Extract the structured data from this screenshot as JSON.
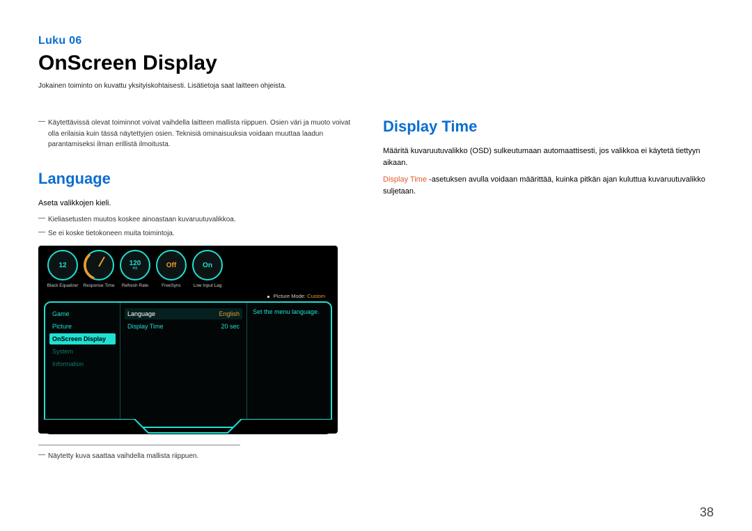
{
  "chapter_label": "Luku 06",
  "page_title": "OnScreen Display",
  "page_subtitle": "Jokainen toiminto on kuvattu yksityiskohtaisesti. Lisätietoja saat laitteen ohjeista.",
  "page_number": "38",
  "left": {
    "top_note": "Käytettävissä olevat toiminnot voivat vaihdella laitteen mallista riippuen. Osien väri ja muoto voivat olla erilaisia kuin tässä näytettyjen osien. Teknisiä ominaisuuksia voidaan muuttaa laadun parantamiseksi ilman erillistä ilmoitusta.",
    "h2": "Language",
    "intro": "Aseta valikkojen kieli.",
    "notes": [
      "Kieliasetusten muutos koskee ainoastaan kuvaruutuvalikkoa.",
      "Se ei koske tietokoneen muita toimintoja."
    ],
    "footnote": "Näytetty kuva saattaa vaihdella mallista riippuen."
  },
  "right": {
    "h2": "Display Time",
    "p1": "Määritä kuvaruutuvalikko (OSD) sulkeutumaan automaattisesti, jos valikkoa ei käytetä tiettyyn aikaan.",
    "p2_prefix": "Display Time",
    "p2_rest": " -asetuksen avulla voidaan määrittää, kuinka pitkän ajan kuluttua kuvaruutuvalikko suljetaan."
  },
  "osd": {
    "dials": [
      {
        "value": "12",
        "sub": "",
        "label": "Black Equalizer"
      },
      {
        "value": "",
        "sub": "",
        "label": "Response Time",
        "gauge": true
      },
      {
        "value": "120",
        "sub": "Hz",
        "label": "Refresh Rate"
      },
      {
        "value": "Off",
        "sub": "",
        "label": "FreeSync",
        "off": true
      },
      {
        "value": "On",
        "sub": "",
        "label": "Low Input Lag"
      }
    ],
    "picture_mode_label": "Picture Mode:",
    "picture_mode_value": "Custom",
    "sidebar": [
      {
        "label": "Game"
      },
      {
        "label": "Picture"
      },
      {
        "label": "OnScreen Display",
        "selected": true
      },
      {
        "label": "System",
        "muted": true
      },
      {
        "label": "Information",
        "muted": true
      }
    ],
    "settings": [
      {
        "label": "Language",
        "value": "English",
        "selected": true
      },
      {
        "label": "Display Time",
        "value": "20 sec"
      }
    ],
    "description": "Set the menu language."
  }
}
